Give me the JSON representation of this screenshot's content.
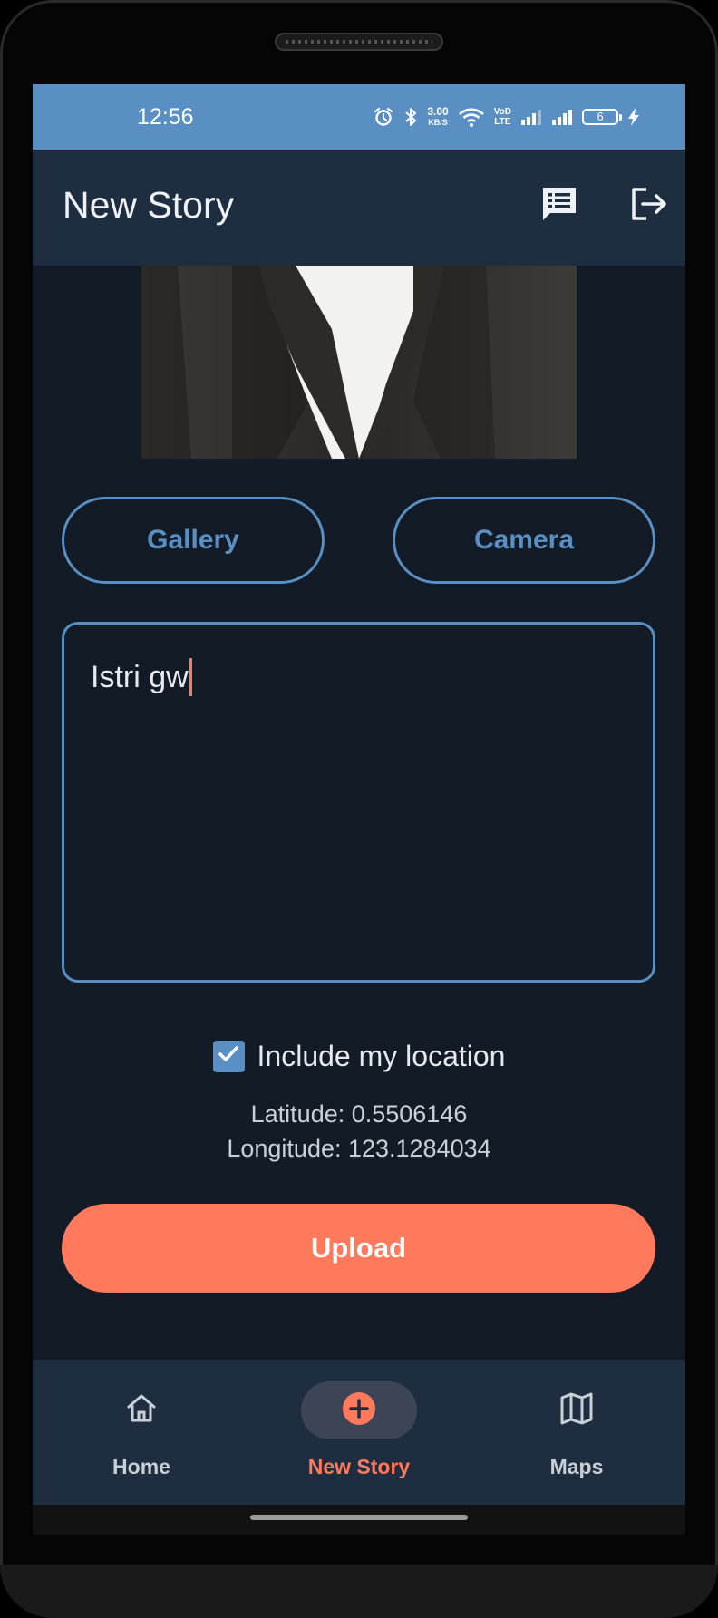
{
  "status_bar": {
    "time": "12:56",
    "net_speed_value": "3.00",
    "net_speed_unit": "KB/S",
    "volte_top": "VoD",
    "volte_bottom": "LTE",
    "battery_level": "6"
  },
  "app_bar": {
    "title": "New Story",
    "stories_icon": "chat-list-icon",
    "logout_icon": "logout-icon"
  },
  "form": {
    "gallery_label": "Gallery",
    "camera_label": "Camera",
    "description_value": "Istri gw",
    "include_location_label": "Include my location",
    "include_location_checked": true,
    "latitude_text": "Latitude: 0.5506146",
    "longitude_text": "Longitude: 123.1284034",
    "upload_label": "Upload"
  },
  "bottom_nav": {
    "items": [
      {
        "label": "Home",
        "icon": "home-icon",
        "active": false
      },
      {
        "label": "New Story",
        "icon": "add-circle-icon",
        "active": true
      },
      {
        "label": "Maps",
        "icon": "map-icon",
        "active": false
      }
    ]
  },
  "colors": {
    "accent_blue": "#5a8fc4",
    "accent_orange": "#ff7a5c",
    "background": "#121b26",
    "surface": "#1e2d40"
  }
}
